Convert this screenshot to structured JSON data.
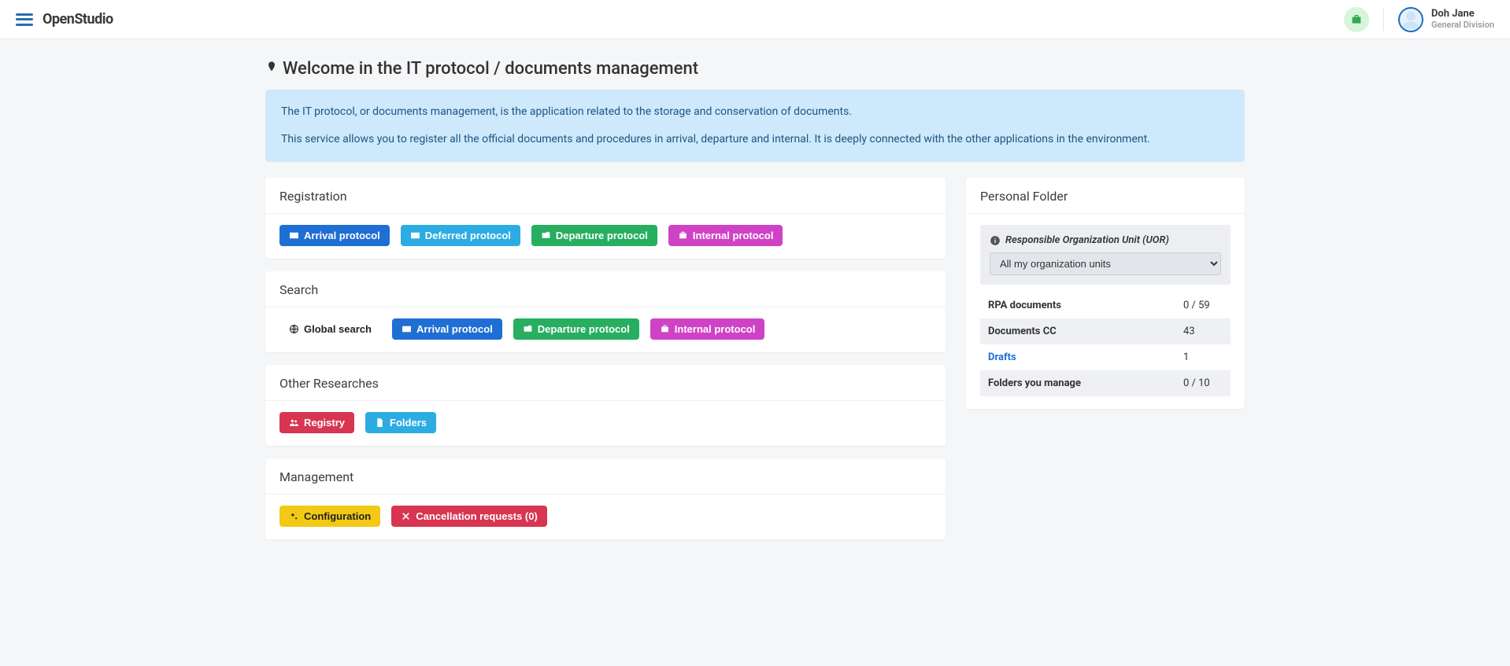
{
  "brand": "OpenStudio",
  "user": {
    "name": "Doh Jane",
    "division": "General Division"
  },
  "page_title": "Welcome in the IT protocol / documents management",
  "banner": {
    "p1": "The IT protocol, or documents management, is the application related to the storage and conservation of documents.",
    "p2": "This service allows you to register all the official documents and procedures in arrival, departure and internal. It is deeply connected with the other applications in the environment."
  },
  "sections": {
    "registration": {
      "title": "Registration",
      "arrival": "Arrival protocol",
      "deferred": "Deferred protocol",
      "departure": "Departure protocol",
      "internal": "Internal protocol"
    },
    "search": {
      "title": "Search",
      "global": "Global search",
      "arrival": "Arrival protocol",
      "departure": "Departure protocol",
      "internal": "Internal protocol"
    },
    "other": {
      "title": "Other Researches",
      "registry": "Registry",
      "folders": "Folders"
    },
    "management": {
      "title": "Management",
      "configuration": "Configuration",
      "cancellation": "Cancellation requests (0)"
    }
  },
  "sidebar": {
    "title": "Personal Folder",
    "uor_label": "Responsible Organization Unit (UOR)",
    "uor_selected": "All my organization units",
    "rows": {
      "rpa": {
        "label": "RPA documents",
        "value": "0 / 59"
      },
      "cc": {
        "label": "Documents CC",
        "value": "43"
      },
      "drafts": {
        "label": "Drafts",
        "value": "1"
      },
      "folders": {
        "label": "Folders you manage",
        "value": "0 / 10"
      }
    }
  }
}
